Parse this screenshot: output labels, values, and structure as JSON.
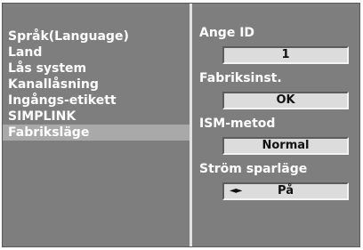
{
  "menu": {
    "items": [
      {
        "label": "Språk(Language)"
      },
      {
        "label": "Land"
      },
      {
        "label": "Lås system"
      },
      {
        "label": "Kanallåsning"
      },
      {
        "label": "Ingångs-etikett"
      },
      {
        "label": "SIMPLINK"
      },
      {
        "label": "Fabriksläge",
        "selected": true
      }
    ]
  },
  "settings": {
    "set_id": {
      "label": "Ange ID",
      "value": "1"
    },
    "factory_reset": {
      "label": "Fabriksinst.",
      "value": "OK"
    },
    "ism_method": {
      "label": "ISM-metod",
      "value": "Normal"
    },
    "power_saving": {
      "label": "Ström sparläge",
      "value": "På",
      "arrows": "◄►"
    }
  },
  "colors": {
    "panel": "#7e7e7e",
    "selected_row": "#a9a9a9",
    "value_box": "#dcdcdc",
    "divider": "#e2e2e2",
    "text": "#ffffff"
  }
}
